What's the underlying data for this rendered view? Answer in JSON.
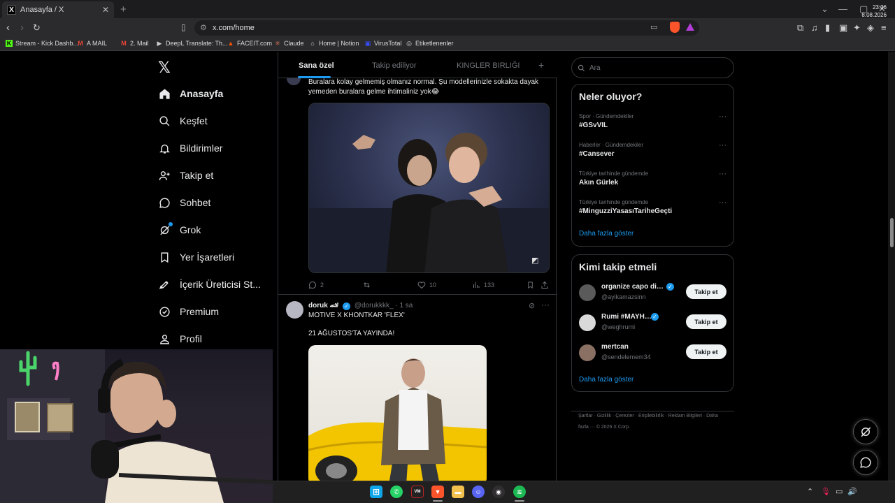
{
  "browser": {
    "tab_title": "Anasayfa / X",
    "tab_favicon": "X",
    "new_tab": "+",
    "url": "x.com/home"
  },
  "bookmarks": [
    {
      "label": "Stream - Kick Dashb...",
      "icon": "K",
      "color": "#53fc18"
    },
    {
      "label": "A MAIL",
      "icon": "M",
      "color": "#ea4335"
    },
    {
      "label": "2. Mail",
      "icon": "M",
      "color": "#ea4335"
    },
    {
      "label": "DeepL Translate: Th...",
      "icon": "▶",
      "color": "#cfcfcf"
    },
    {
      "label": "FACEIT.com",
      "icon": "▲",
      "color": "#ff5500"
    },
    {
      "label": "Claude",
      "icon": "✳",
      "color": "#d97757"
    },
    {
      "label": "Home | Notion",
      "icon": "⌂",
      "color": "#cfcfcf"
    },
    {
      "label": "VirusTotal",
      "icon": "▣",
      "color": "#394eff"
    },
    {
      "label": "Etiketlenenler",
      "icon": "◎",
      "color": "#cfcfcf"
    }
  ],
  "nav": {
    "items": [
      {
        "label": "Anasayfa",
        "icon": "home-icon"
      },
      {
        "label": "Keşfet",
        "icon": "search-icon"
      },
      {
        "label": "Bildirimler",
        "icon": "bell-icon"
      },
      {
        "label": "Takip et",
        "icon": "follow-icon"
      },
      {
        "label": "Sohbet",
        "icon": "chat-icon"
      },
      {
        "label": "Grok",
        "icon": "grok-icon"
      },
      {
        "label": "Yer İşaretleri",
        "icon": "bookmark-icon"
      },
      {
        "label": "İçerik Üreticisi St...",
        "icon": "rocket-icon"
      },
      {
        "label": "Premium",
        "icon": "premium-icon"
      },
      {
        "label": "Profil",
        "icon": "profile-icon"
      }
    ]
  },
  "timeline": {
    "tabs": [
      "Sana özel",
      "Takip ediliyor",
      "KINGLER BIRLIĞI"
    ],
    "tweet1": {
      "text_line1": "Buralara kolay gelmemiş olmanız normal. Şu modellerinizle sokakta dayak",
      "text_line2": "yemeden buralara gelme ihtimaliniz yok😂",
      "replies": "2",
      "likes": "10",
      "views": "133"
    },
    "tweet2": {
      "name": "doruk 🏎",
      "handle": "@dorukkkk_",
      "time": "· 1 sa",
      "text_line1": "MOTIVE X KHONTKAR 'FLEX'",
      "text_line2": "21 AĞUSTOS'TA YAYINDA!"
    }
  },
  "sidebar": {
    "search_placeholder": "Ara",
    "trends_title": "Neler oluyor?",
    "trends": [
      {
        "category": "Spor · Gündemdekiler",
        "name": "#GSvVIL"
      },
      {
        "category": "Haberler · Gündemdekiler",
        "name": "#Cansever"
      },
      {
        "category": "Türkiye tarihinde gündemde",
        "name": "Akın Gürlek"
      },
      {
        "category": "Türkiye tarihinde gündemde",
        "name": "#MinguzziYasasıTariheGeçti"
      }
    ],
    "show_more": "Daha fazla göster",
    "wtf_title": "Kimi takip etmeli",
    "who_to_follow": [
      {
        "name": "organize capo di t...",
        "handle": "@ayikamazsinn",
        "verified": true,
        "avatar": "#5a5a5a"
      },
      {
        "name": "Rumi #MAYHEM",
        "handle": "@weghrumi",
        "verified": true,
        "avatar": "#d9d9d9"
      },
      {
        "name": "mertcan",
        "handle": "@sendelemem34",
        "verified": false,
        "avatar": "#8a6f63"
      }
    ],
    "follow_label": "Takip et",
    "footer": "Şartlar · Gizlilik · Çerezler · Erişilebilirlik · Reklam Bilgileri · Daha fazla ··· © 2026 X Corp."
  },
  "taskbar": {
    "time": "23:36",
    "date": "8.08.2026",
    "apps": [
      "windows",
      "whatsapp",
      "voicemeeter",
      "brave",
      "files",
      "discord",
      "obs",
      "spotify"
    ]
  }
}
